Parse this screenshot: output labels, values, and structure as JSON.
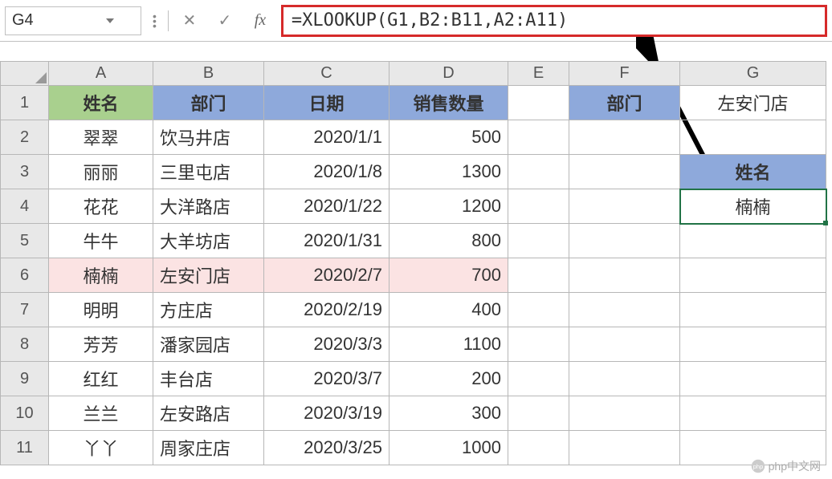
{
  "name_box": "G4",
  "formula_text": "=XLOOKUP(G1,B2:B11,A2:A11)",
  "columns": [
    "A",
    "B",
    "C",
    "D",
    "E",
    "F",
    "G"
  ],
  "rows": [
    "1",
    "2",
    "3",
    "4",
    "5",
    "6",
    "7",
    "8",
    "9",
    "10",
    "11"
  ],
  "main_table": {
    "headers": [
      "姓名",
      "部门",
      "日期",
      "销售数量"
    ],
    "data": [
      {
        "name": "翠翠",
        "dept": "饮马井店",
        "date": "2020/1/1",
        "qty": "500"
      },
      {
        "name": "丽丽",
        "dept": "三里屯店",
        "date": "2020/1/8",
        "qty": "1300"
      },
      {
        "name": "花花",
        "dept": "大洋路店",
        "date": "2020/1/22",
        "qty": "1200"
      },
      {
        "name": "牛牛",
        "dept": "大羊坊店",
        "date": "2020/1/31",
        "qty": "800"
      },
      {
        "name": "楠楠",
        "dept": "左安门店",
        "date": "2020/2/7",
        "qty": "700"
      },
      {
        "name": "明明",
        "dept": "方庄店",
        "date": "2020/2/19",
        "qty": "400"
      },
      {
        "name": "芳芳",
        "dept": "潘家园店",
        "date": "2020/3/3",
        "qty": "1100"
      },
      {
        "name": "红红",
        "dept": "丰台店",
        "date": "2020/3/7",
        "qty": "200"
      },
      {
        "name": "兰兰",
        "dept": "左安路店",
        "date": "2020/3/19",
        "qty": "300"
      },
      {
        "name": "丫丫",
        "dept": "周家庄店",
        "date": "2020/3/25",
        "qty": "1000"
      }
    ]
  },
  "lookup_block": {
    "f1_label": "部门",
    "g1_value": "左安门店",
    "g3_label": "姓名",
    "g4_result": "楠楠"
  },
  "highlight_row_index": 4,
  "watermark_text": "php中文网"
}
